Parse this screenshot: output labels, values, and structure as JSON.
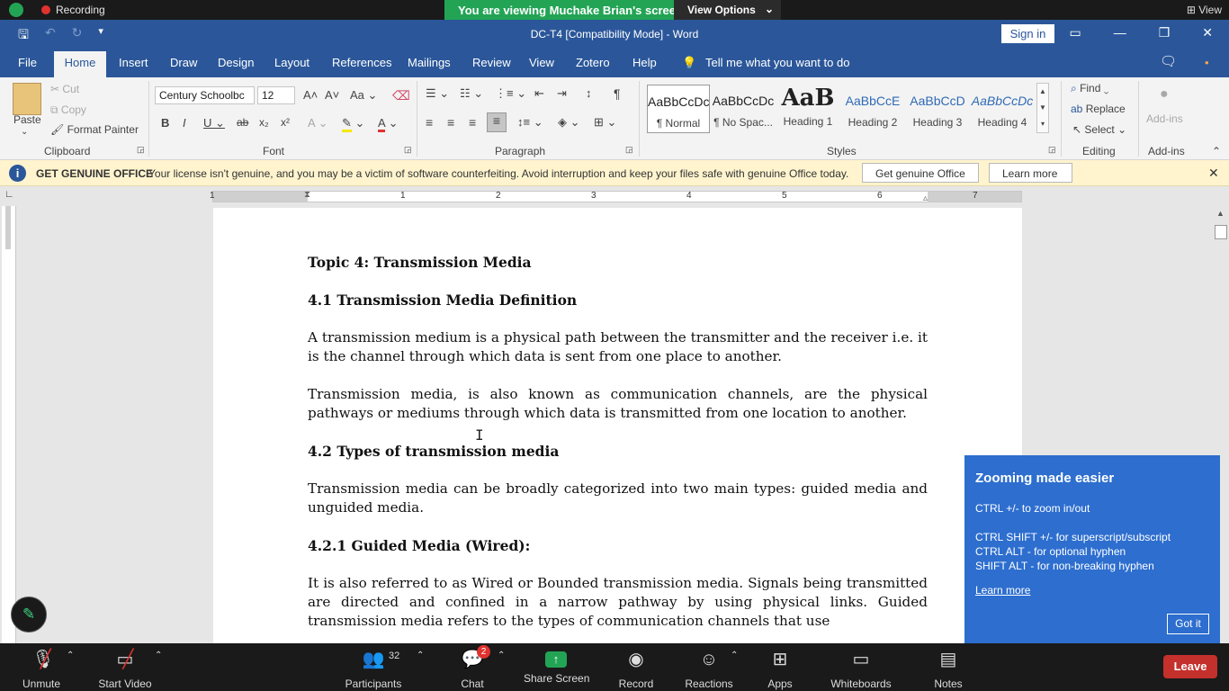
{
  "zoom": {
    "recording_label": "Recording",
    "viewing_banner": "You are viewing Muchake Brian's screen",
    "view_options": "View Options",
    "view_label": "View",
    "bottom": {
      "unmute": "Unmute",
      "start_video": "Start Video",
      "participants": "Participants",
      "participant_count": "32",
      "chat": "Chat",
      "chat_badge": "2",
      "share_screen": "Share Screen",
      "record": "Record",
      "reactions": "Reactions",
      "apps": "Apps",
      "whiteboards": "Whiteboards",
      "notes": "Notes",
      "leave": "Leave"
    }
  },
  "word": {
    "title": "DC-T4 [Compatibility Mode]  -  Word",
    "sign_in": "Sign in",
    "tabs": [
      "File",
      "Home",
      "Insert",
      "Draw",
      "Design",
      "Layout",
      "References",
      "Mailings",
      "Review",
      "View",
      "Zotero",
      "Help"
    ],
    "tell_me": "Tell me what you want to do",
    "clipboard": {
      "paste": "Paste",
      "cut": "Cut",
      "copy": "Copy",
      "format_painter": "Format Painter",
      "label": "Clipboard"
    },
    "font": {
      "name": "Century Schoolbc",
      "size": "12",
      "label": "Font"
    },
    "paragraph_label": "Paragraph",
    "styles": {
      "label": "Styles",
      "items": [
        {
          "preview": "AaBbCcDc",
          "name": "¶ Normal"
        },
        {
          "preview": "AaBbCcDc",
          "name": "¶ No Spac..."
        },
        {
          "preview": "AaB",
          "name": "Heading 1"
        },
        {
          "preview": "AaBbCcE",
          "name": "Heading 2"
        },
        {
          "preview": "AaBbCcD",
          "name": "Heading 3"
        },
        {
          "preview": "AaBbCcDc",
          "name": "Heading 4"
        }
      ]
    },
    "editing": {
      "find": "Find",
      "replace": "Replace",
      "select": "Select",
      "label": "Editing"
    },
    "addins": {
      "button": "Add-ins",
      "label": "Add-ins"
    },
    "genuine": {
      "title": "GET GENUINE OFFICE",
      "message": "Your license isn't genuine, and you may be a victim of software counterfeiting. Avoid interruption and keep your files safe with genuine Office today.",
      "get_button": "Get genuine Office",
      "learn_button": "Learn more"
    },
    "ruler_numbers": [
      "1",
      "1",
      "2",
      "3",
      "4",
      "5",
      "6",
      "7"
    ],
    "document": {
      "h_topic": "Topic 4: Transmission Media",
      "h_41": "4.1 Transmission Media Definition",
      "p1": "A transmission medium is a physical path between the transmitter and the receiver i.e. it is the channel through which data is sent from one place to another.",
      "p2": "Transmission media, is also known as communication channels, are the physical pathways or mediums through which data is transmitted from one location to another.",
      "h_42": "4.2 Types of transmission media",
      "p3": "Transmission media can be broadly categorized into two main types: guided media and unguided media.",
      "h_421": "4.2.1 Guided Media (Wired):",
      "p4": "It is also referred to as Wired or Bounded transmission media. Signals being transmitted are directed and confined in a narrow pathway by using physical links. Guided transmission media refers to the types of communication channels that use"
    }
  },
  "tooltip": {
    "title": "Zooming made easier",
    "line1": "CTRL +/- to zoom in/out",
    "line2": "CTRL SHIFT +/- for superscript/subscript",
    "line3": "CTRL ALT - for optional hyphen",
    "line4": "SHIFT ALT - for non-breaking hyphen",
    "link": "Learn more",
    "button": "Got it"
  }
}
